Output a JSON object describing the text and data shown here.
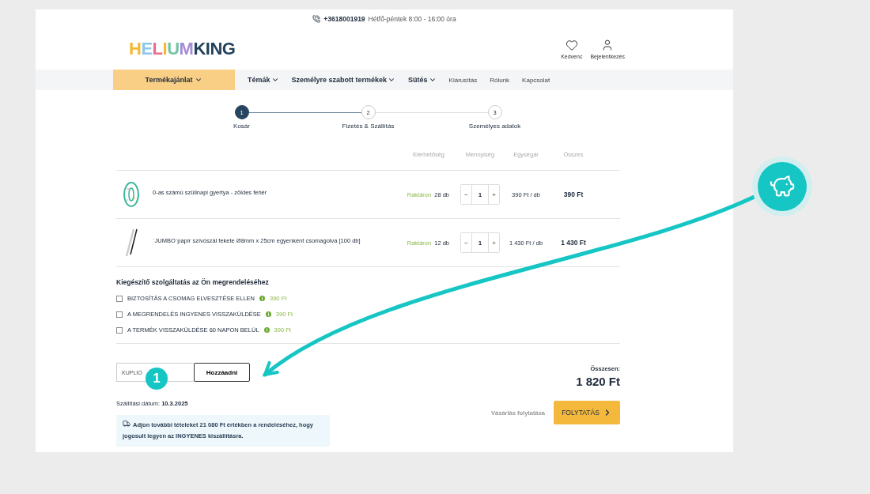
{
  "top_bar": {
    "phone": "+3618001919",
    "hours": "Hétfő-péntek 8:00 - 16:00 óra"
  },
  "logo": {
    "parts": [
      "HELIUM",
      "KING"
    ]
  },
  "header_actions": [
    {
      "label": "Kedvenc",
      "kind": "heart"
    },
    {
      "label": "Bejelentkezés",
      "kind": "user"
    }
  ],
  "nav": {
    "primary": "Termékajánlat",
    "items": [
      {
        "label": "Témák",
        "dropdown": true
      },
      {
        "label": "Személyre szabott termékek",
        "dropdown": true
      },
      {
        "label": "Sütés",
        "dropdown": true
      },
      {
        "label": "Kiárusítás",
        "dropdown": false
      },
      {
        "label": "Rólunk",
        "dropdown": false
      },
      {
        "label": "Kapcsolat",
        "dropdown": false
      }
    ]
  },
  "steps": [
    {
      "number": "1",
      "label": "Kosár",
      "selected": true
    },
    {
      "number": "2",
      "label": "Fizetés & Szállítás",
      "selected": false
    },
    {
      "number": "3",
      "label": "Személyes adatok",
      "selected": false
    }
  ],
  "cart": {
    "columns": [
      "Elérhetőség",
      "Mennyiség",
      "Egységár",
      "Összes"
    ],
    "rows": [
      {
        "kind": "candle",
        "name": "0-as számú szülinapi gyertya - zöldes fehér",
        "stock_label": "Raktáron",
        "stock": "28 db",
        "decrement": "−",
        "quantity": "1",
        "increment": "+",
        "unit_price": "390 Ft / db",
        "total": "390 Ft"
      },
      {
        "kind": "straw",
        "name": "`JUMBO`papír szívószál fekete Ø8mm x 25cm egyenként csomagolva [100 db]",
        "stock_label": "Raktáron",
        "stock": "12 db",
        "decrement": "−",
        "quantity": "1",
        "increment": "+",
        "unit_price": "1 430 Ft / db",
        "total": "1 430 Ft"
      }
    ]
  },
  "extras": {
    "title": "Kiegészítő szolgáltatás az Ön megrendeléséhez",
    "items": [
      {
        "label": "BIZTOSÍTÁS A CSOMAG ELVESZTÉSE ELLEN",
        "price": "390 Ft",
        "checked": false
      },
      {
        "label": "A MEGRENDELÉS INGYENES VISSZAKÜLDÉSE",
        "price": "390 Ft",
        "checked": false
      },
      {
        "label": "A TERMÉK VISSZAKÜLDÉSE 60 NAPON BELÜL",
        "price": "390 Ft",
        "checked": false
      }
    ]
  },
  "coupon": {
    "placeholder": "KUPLIO",
    "button": "Hozzáadni"
  },
  "delivery": {
    "label": "Szállítási dátum:",
    "date": "10.3.2025"
  },
  "notice": "Adjon további tételeket **21 080 Ft** értékben a rendeléséhez, hogy jogosult legyen az **INGYENES** kiszállításra.",
  "summary": {
    "label": "Összesen:",
    "total": "1 820 Ft",
    "continue_link": "Vásárlás folytatása",
    "checkout": "FOLYTATÁS"
  },
  "annotation": {
    "marker": "1"
  }
}
